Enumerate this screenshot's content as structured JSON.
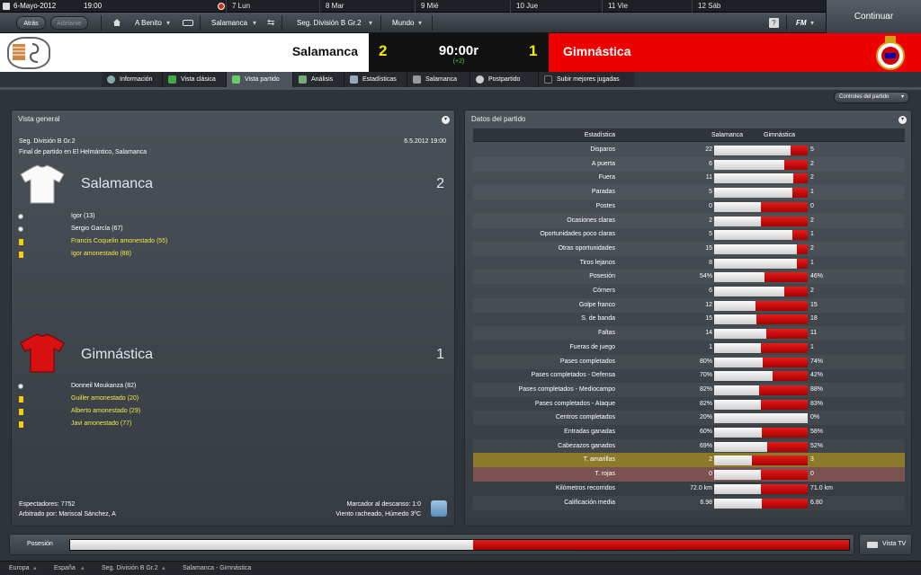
{
  "topbar": {
    "date": "6-Mayo-2012",
    "time": "19:00",
    "days": [
      "7 Lun",
      "8 Mar",
      "9 Mié",
      "10 Jue",
      "11 Vie",
      "12 Sáb"
    ]
  },
  "nav": {
    "back": "Atrás",
    "forward": "Adelante",
    "manager": "A Benito",
    "club": "Salamanca",
    "competition": "Seg. División B Gr.2",
    "world": "Mundo",
    "help": "?",
    "fm": "FM",
    "continue": "Continuar"
  },
  "score": {
    "home": "Salamanca",
    "home_goals": "2",
    "away": "Gimnástica",
    "away_goals": "1",
    "clock": "90:00r",
    "added": "(+2)"
  },
  "tabs": [
    "Información",
    "Vista clásica",
    "Vista partido",
    "Análisis",
    "Estadísticas",
    "Salamanca",
    "Postpartido",
    "Subir mejores jugadas"
  ],
  "controls_label": "Controles del partido",
  "overview": {
    "title": "Vista general",
    "competition": "Seg. División B Gr.2",
    "datetime": "6.5.2012 19:00",
    "venue": "Final de partido en El Helmántico, Salamanca",
    "home": {
      "name": "Salamanca",
      "goals": "2",
      "events": [
        {
          "type": "goal",
          "text": "Igor (13)"
        },
        {
          "type": "goal",
          "text": "Sergio García (67)"
        },
        {
          "type": "card",
          "text": "Francis Coquelin amonestado (55)"
        },
        {
          "type": "card",
          "text": "Igor amonestado (88)"
        }
      ]
    },
    "away": {
      "name": "Gimnástica",
      "goals": "1",
      "events": [
        {
          "type": "goal",
          "text": "Donneil Moukanza (82)"
        },
        {
          "type": "card",
          "text": "Guiller amonestado (20)"
        },
        {
          "type": "card",
          "text": "Alberto amonestado (29)"
        },
        {
          "type": "card",
          "text": "Javi amonestado (77)"
        }
      ]
    },
    "attendance": "Espectadores: 7752",
    "referee": "Arbitrado por: Mariscal Sánchez, A",
    "halftime": "Marcador al descanso: 1:0",
    "weather": "Viento racheado, Húmedo 3ºC"
  },
  "stats": {
    "title": "Datos del partido",
    "col_stat": "Estadística",
    "col_home": "Salamanca",
    "col_away": "Gimnástica",
    "rows": [
      {
        "label": "Disparos",
        "home": "22",
        "away": "5",
        "share": 0.815
      },
      {
        "label": "A puerta",
        "home": "6",
        "away": "2",
        "share": 0.75
      },
      {
        "label": "Fuera",
        "home": "11",
        "away": "2",
        "share": 0.846
      },
      {
        "label": "Paradas",
        "home": "5",
        "away": "1",
        "share": 0.833
      },
      {
        "label": "Postes",
        "home": "0",
        "away": "0",
        "share": 0.5
      },
      {
        "label": "Ocasiones claras",
        "home": "2",
        "away": "2",
        "share": 0.5
      },
      {
        "label": "Oportunidades poco claras",
        "home": "5",
        "away": "1",
        "share": 0.833
      },
      {
        "label": "Otras oportunidades",
        "home": "15",
        "away": "2",
        "share": 0.882
      },
      {
        "label": "Tiros lejanos",
        "home": "8",
        "away": "1",
        "share": 0.889
      },
      {
        "label": "Posesión",
        "home": "54%",
        "away": "46%",
        "share": 0.54
      },
      {
        "label": "Córners",
        "home": "6",
        "away": "2",
        "share": 0.75
      },
      {
        "label": "Golpe franco",
        "home": "12",
        "away": "15",
        "share": 0.444
      },
      {
        "label": "S. de banda",
        "home": "15",
        "away": "18",
        "share": 0.455
      },
      {
        "label": "Faltas",
        "home": "14",
        "away": "11",
        "share": 0.56
      },
      {
        "label": "Fueras de juego",
        "home": "1",
        "away": "1",
        "share": 0.5
      },
      {
        "label": "Pases completados",
        "home": "80%",
        "away": "74%",
        "share": 0.52
      },
      {
        "label": "Pases completados - Defensa",
        "home": "70%",
        "away": "42%",
        "share": 0.625
      },
      {
        "label": "Pases completados - Mediocampo",
        "home": "82%",
        "away": "88%",
        "share": 0.482
      },
      {
        "label": "Pases completados - Ataque",
        "home": "82%",
        "away": "83%",
        "share": 0.497
      },
      {
        "label": "Centros completados",
        "home": "20%",
        "away": "0%",
        "share": 1.0
      },
      {
        "label": "Entradas ganadas",
        "home": "60%",
        "away": "58%",
        "share": 0.508
      },
      {
        "label": "Cabezazos ganados",
        "home": "69%",
        "away": "52%",
        "share": 0.57
      },
      {
        "label": "T. amarillas",
        "home": "2",
        "away": "3",
        "share": 0.4,
        "highlight": "#8a7a2a"
      },
      {
        "label": "T. rojas",
        "home": "0",
        "away": "0",
        "share": 0.5,
        "highlight": "#7a5252"
      },
      {
        "label": "Kilómetros recorridos",
        "home": "72.0 km",
        "away": "71.0 km",
        "share": 0.503
      },
      {
        "label": "Calificación media",
        "home": "6.98",
        "away": "6.80",
        "share": 0.507
      }
    ]
  },
  "possession": {
    "label": "Posesión",
    "home_share": 0.54
  },
  "tv_button": "Vista TV",
  "breadcrumbs": [
    "Europa",
    "España",
    "Seg. División B Gr.2",
    "Salamanca - Gimnástica"
  ],
  "colors": {
    "home": "#ffffff",
    "away": "#e00000",
    "accent_yellow": "#f6e84c"
  }
}
